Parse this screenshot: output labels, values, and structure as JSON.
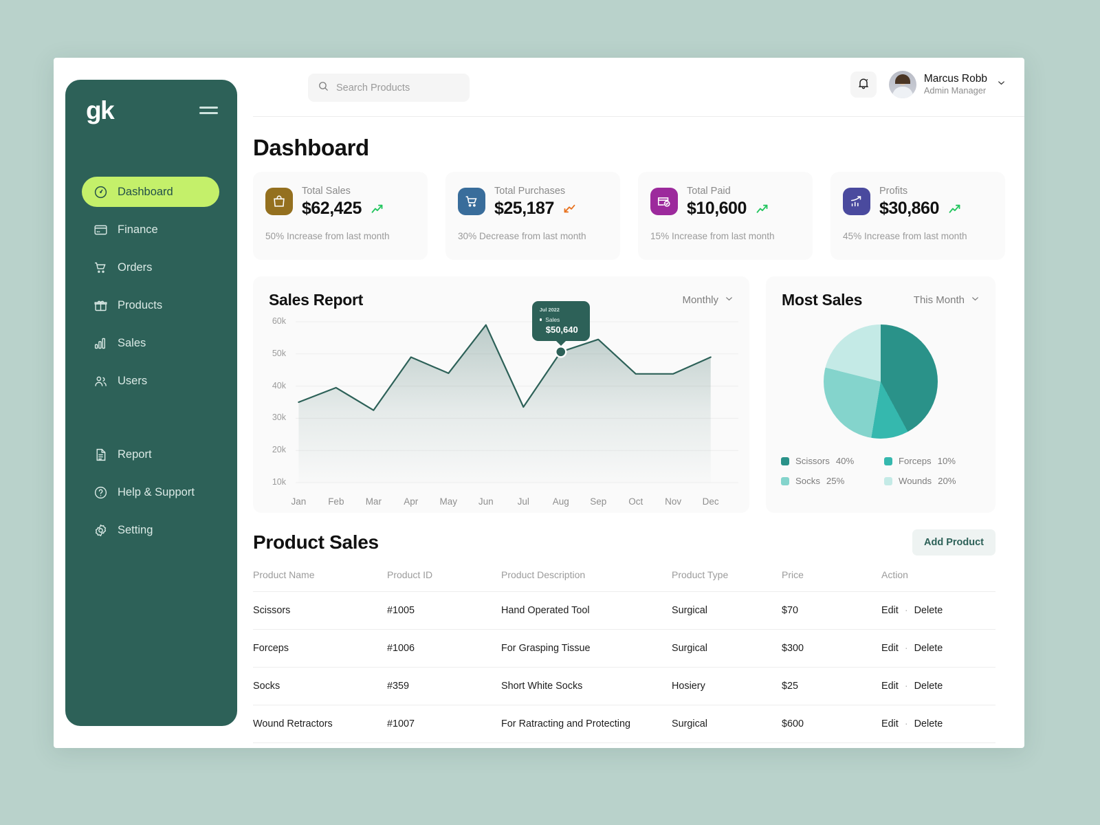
{
  "brand": {
    "logo_text": "gk",
    "menu_icon": "hamburger-icon"
  },
  "sidebar": {
    "primary": [
      {
        "label": "Dashboard",
        "icon": "gauge-icon",
        "active": true
      },
      {
        "label": "Finance",
        "icon": "card-icon",
        "active": false
      },
      {
        "label": "Orders",
        "icon": "cart-icon",
        "active": false
      },
      {
        "label": "Products",
        "icon": "gift-icon",
        "active": false
      },
      {
        "label": "Sales",
        "icon": "bar-chart-icon",
        "active": false
      },
      {
        "label": "Users",
        "icon": "users-icon",
        "active": false
      }
    ],
    "secondary": [
      {
        "label": "Report",
        "icon": "document-icon"
      },
      {
        "label": "Help & Support",
        "icon": "question-circle-icon"
      },
      {
        "label": "Setting",
        "icon": "gear-icon"
      }
    ]
  },
  "topbar": {
    "search_placeholder": "Search Products",
    "search_value": "",
    "search_icon": "search-icon",
    "bell_icon": "bell-icon",
    "profile": {
      "name": "Marcus Robb",
      "role": "Admin Manager",
      "chevron": "chevron-down-icon"
    }
  },
  "page": {
    "title": "Dashboard"
  },
  "stats": [
    {
      "label": "Total Sales",
      "value": "$62,425",
      "note": "50% Increase from last month",
      "trend": "up",
      "icon": "bag-icon",
      "color": "#94701f"
    },
    {
      "label": "Total Purchases",
      "value": "$25,187",
      "note": "30% Decrease from last month",
      "trend": "down",
      "icon": "cart-icon",
      "color": "#396d9b"
    },
    {
      "label": "Total Paid",
      "value": "$10,600",
      "note": "15% Increase from last month",
      "trend": "up",
      "icon": "card-check-icon",
      "color": "#9c2a9c"
    },
    {
      "label": "Profits",
      "value": "$30,860",
      "note": "45% Increase from last month",
      "trend": "up",
      "icon": "growth-chart-icon",
      "color": "#4a4a9e"
    }
  ],
  "sales_report": {
    "title": "Sales Report",
    "range_label": "Monthly",
    "range_chevron": "chevron-down-icon",
    "tooltip": {
      "date": "Jul 2022",
      "series": "Sales",
      "value": "$50,640"
    }
  },
  "most_sales": {
    "title": "Most Sales",
    "range_label": "This Month",
    "range_chevron": "chevron-down-icon"
  },
  "product_sales": {
    "title": "Product Sales",
    "add_button": "Add Product",
    "columns": [
      "Product Name",
      "Product ID",
      "Product Description",
      "Product Type",
      "Price",
      "Action"
    ],
    "rows": [
      {
        "name": "Scissors",
        "id": "#1005",
        "description": "Hand Operated Tool",
        "type": "Surgical",
        "price": "$70",
        "edit": "Edit",
        "sep": "·",
        "delete": "Delete"
      },
      {
        "name": "Forceps",
        "id": "#1006",
        "description": "For Grasping Tissue",
        "type": "Surgical",
        "price": "$300",
        "edit": "Edit",
        "sep": "·",
        "delete": "Delete"
      },
      {
        "name": "Socks",
        "id": "#359",
        "description": "Short White Socks",
        "type": "Hosiery",
        "price": "$25",
        "edit": "Edit",
        "sep": "·",
        "delete": "Delete"
      },
      {
        "name": "Wound Retractors",
        "id": "#1007",
        "description": "For Ratracting and Protecting",
        "type": "Surgical",
        "price": "$600",
        "edit": "Edit",
        "sep": "·",
        "delete": "Delete"
      }
    ]
  },
  "chart_data": [
    {
      "type": "area",
      "title": "Sales Report",
      "xlabel": "",
      "ylabel": "",
      "x": [
        "Jan",
        "Feb",
        "Mar",
        "Apr",
        "May",
        "Jun",
        "Jul",
        "Aug",
        "Sep",
        "Oct",
        "Nov",
        "Dec"
      ],
      "tick_labels_y": [
        "60k",
        "50k",
        "40k",
        "30k",
        "20k",
        "10k"
      ],
      "ylim": [
        10000,
        60000
      ],
      "grid": true,
      "legend": "none",
      "series": [
        {
          "name": "Sales",
          "values": [
            35000,
            39500,
            32500,
            49000,
            44000,
            59000,
            33500,
            50640,
            54500,
            43800,
            43800,
            49000
          ]
        }
      ],
      "highlight": {
        "x": "Jul",
        "label": "Jul 2022",
        "series": "Sales",
        "value": "$50,640"
      }
    },
    {
      "type": "pie",
      "title": "Most Sales",
      "range": "This Month",
      "legend": "bottom",
      "categories": [
        "Scissors",
        "Forceps",
        "Socks",
        "Wounds"
      ],
      "values": [
        40,
        10,
        25,
        20
      ],
      "value_labels": [
        "40%",
        "10%",
        "25%",
        "20%"
      ],
      "colors": [
        "#2a9289",
        "#35b8ae",
        "#84d4cc",
        "#c4eae6"
      ]
    }
  ],
  "theme": {
    "sidebar_bg": "#2d6158",
    "active_nav_bg": "#c4f06a",
    "accent": "#2d6158",
    "trend_up": "#22c55e",
    "trend_down": "#e8721f",
    "card_bg": "#fafafa"
  }
}
